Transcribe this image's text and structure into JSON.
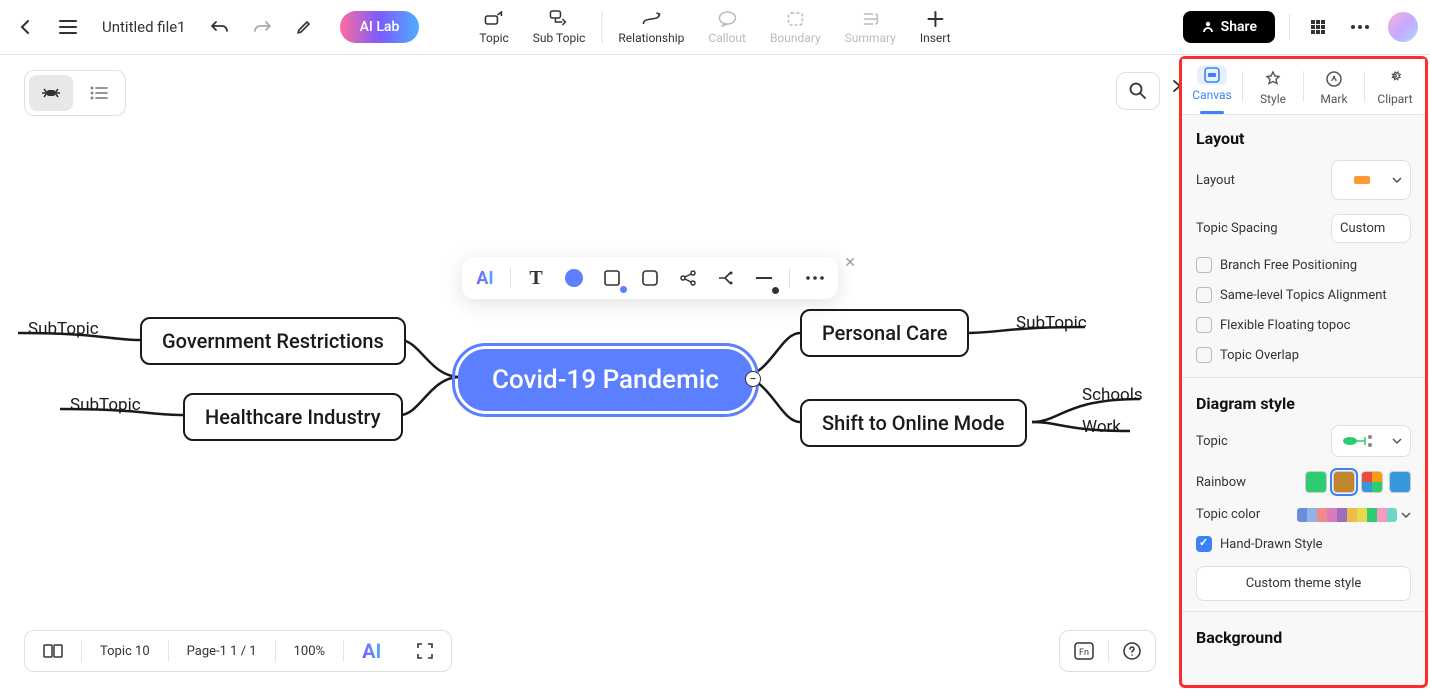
{
  "file": {
    "title": "Untitled file1"
  },
  "ai_lab": "AI Lab",
  "top_tools": {
    "topic": "Topic",
    "subtopic": "Sub Topic",
    "relationship": "Relationship",
    "callout": "Callout",
    "boundary": "Boundary",
    "summary": "Summary",
    "insert": "Insert"
  },
  "share": "Share",
  "mindmap": {
    "center": "Covid-19 Pandemic",
    "left": [
      {
        "label": "Government Restrictions",
        "sub": "SubTopic"
      },
      {
        "label": "Healthcare Industry",
        "sub": "SubTopic"
      }
    ],
    "right": [
      {
        "label": "Personal Care",
        "sub": "SubTopic"
      },
      {
        "label": "Shift to Online Mode",
        "subs": [
          "Schools",
          "Work"
        ]
      }
    ]
  },
  "panel": {
    "tabs": {
      "canvas": "Canvas",
      "style": "Style",
      "mark": "Mark",
      "clipart": "Clipart"
    },
    "layout": {
      "title": "Layout",
      "layout_label": "Layout",
      "spacing_label": "Topic Spacing",
      "spacing_value": "Custom",
      "checks": {
        "branch_free": "Branch Free Positioning",
        "same_level": "Same-level Topics Alignment",
        "flexible": "Flexible Floating topoc",
        "overlap": "Topic Overlap"
      }
    },
    "diagram": {
      "title": "Diagram style",
      "topic_label": "Topic",
      "rainbow_label": "Rainbow",
      "topic_color_label": "Topic color",
      "hand_drawn": "Hand-Drawn Style",
      "custom_theme": "Custom theme style"
    },
    "background": {
      "title": "Background"
    }
  },
  "bottom": {
    "topic_count": "Topic 10",
    "page": "Page-1  1 / 1",
    "zoom": "100%"
  },
  "chart_data": {
    "type": "mindmap",
    "title": "Covid-19 Pandemic",
    "root": "Covid-19 Pandemic",
    "children": [
      {
        "label": "Government Restrictions",
        "side": "left",
        "children": [
          {
            "label": "SubTopic"
          }
        ]
      },
      {
        "label": "Healthcare Industry",
        "side": "left",
        "children": [
          {
            "label": "SubTopic"
          }
        ]
      },
      {
        "label": "Personal Care",
        "side": "right",
        "children": [
          {
            "label": "SubTopic"
          }
        ]
      },
      {
        "label": "Shift to Online Mode",
        "side": "right",
        "children": [
          {
            "label": "Schools"
          },
          {
            "label": "Work"
          }
        ]
      }
    ]
  }
}
